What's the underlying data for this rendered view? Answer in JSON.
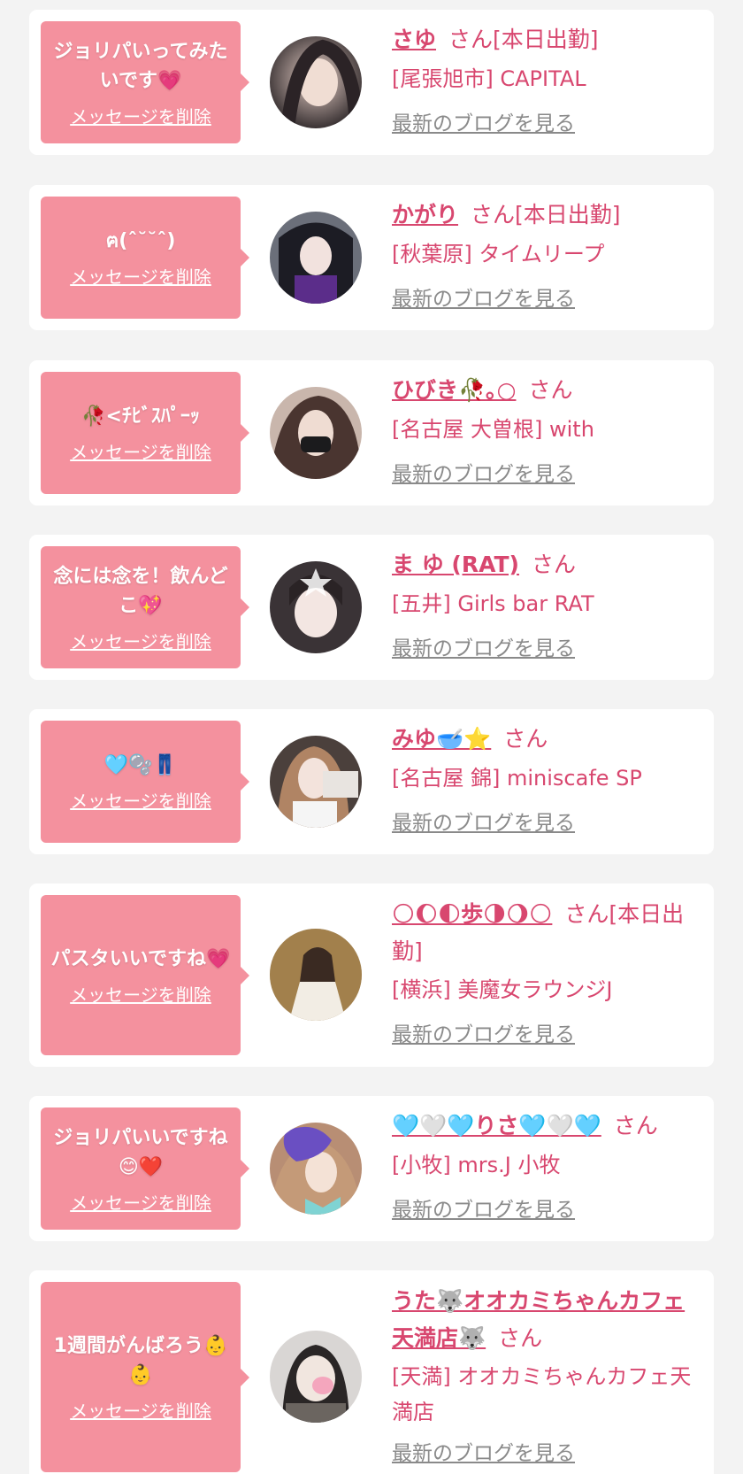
{
  "cards": [
    {
      "message": "ジョリパいってみたいです💗",
      "delete_label": "メッセージを削除",
      "name": "さゆ",
      "san_suffix": "さん[本日出勤]",
      "shop": "[尾張旭市] CAPITAL",
      "blog_label": "最新のブログを見る"
    },
    {
      "message": "ฅ(ˆ˘˘ˆ)",
      "delete_label": "メッセージを削除",
      "name": "かがり",
      "san_suffix": "さん[本日出勤]",
      "shop": "[秋葉原] タイムリープ",
      "blog_label": "最新のブログを見る"
    },
    {
      "message": "🥀<ﾁﾋﾞｽﾊﾟｰｯ",
      "delete_label": "メッセージを削除",
      "name": "ひびき🥀｡○",
      "san_suffix": "さん",
      "shop": "[名古屋 大曽根] with",
      "blog_label": "最新のブログを見る"
    },
    {
      "message": "念には念を！飲んどこ💖",
      "delete_label": "メッセージを削除",
      "name": "ま ゆ (RAT)",
      "san_suffix": "さん",
      "shop": "[五井] Girls bar RAT",
      "blog_label": "最新のブログを見る"
    },
    {
      "message": "🩵🫧👖",
      "delete_label": "メッセージを削除",
      "name": "みゆ🥣⭐",
      "san_suffix": "さん",
      "shop": "[名古屋 錦] miniscafe SP",
      "blog_label": "最新のブログを見る"
    },
    {
      "message": "パスタいいですね💗",
      "delete_label": "メッセージを削除",
      "name": "🌕🌔🌓歩🌗🌖🌕",
      "san_suffix": "さん[本日出勤]",
      "shop": "[横浜] 美魔女ラウンジJ",
      "blog_label": "最新のブログを見る"
    },
    {
      "message": "ジョリパいいですね😊❤️",
      "delete_label": "メッセージを削除",
      "name": "🩵🤍🩵りさ🩵🤍🩵",
      "san_suffix": "さん",
      "shop": "[小牧] mrs.J 小牧",
      "blog_label": "最新のブログを見る"
    },
    {
      "message": "1週間がんばろう👶👶",
      "delete_label": "メッセージを削除",
      "name": "うた🐺オオカミちゃんカフェ天満店🐺",
      "san_suffix": "さん",
      "shop": "[天満] オオカミちゃんカフェ天満店",
      "blog_label": "最新のブログを見る"
    }
  ],
  "colors": {
    "accent": "#d8476f",
    "bubble": "#f4919e",
    "background": "#f3f3f3"
  }
}
